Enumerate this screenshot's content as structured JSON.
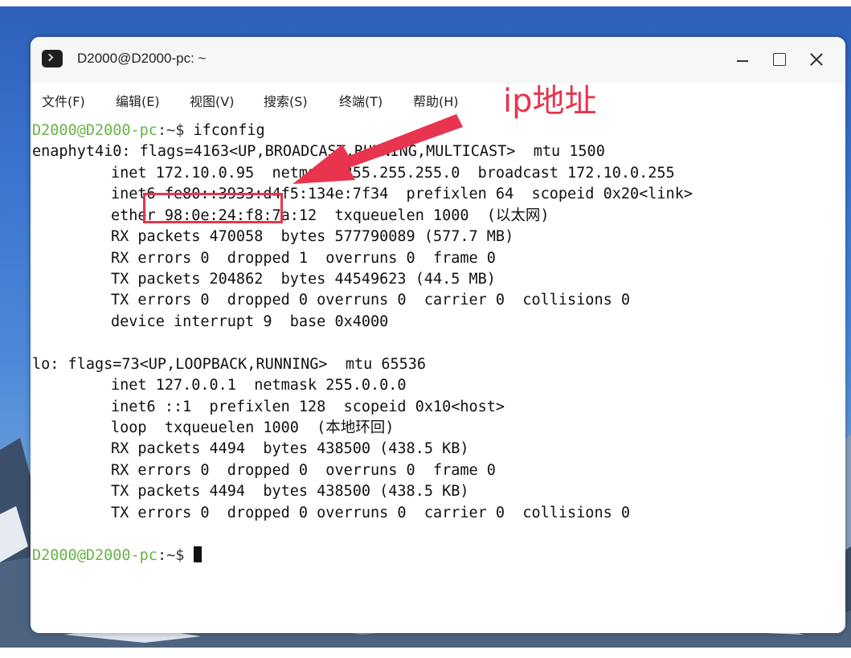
{
  "window": {
    "title": "D2000@D2000-pc: ~"
  },
  "menu": {
    "items": [
      "文件(F)",
      "编辑(E)",
      "视图(V)",
      "搜索(S)",
      "终端(T)",
      "帮助(H)"
    ]
  },
  "annotation": {
    "label": "ip地址",
    "color": "#e8344e"
  },
  "terminal": {
    "prompt_user": "D2000@D2000-pc",
    "prompt_path": ":~$ ",
    "command": "ifconfig",
    "lines": [
      "enaphyt4i0: flags=4163<UP,BROADCAST,RUNNING,MULTICAST>  mtu 1500",
      "inet 172.10.0.95  netmask 255.255.255.0  broadcast 172.10.0.255",
      "inet6 fe80::3933:d4f5:134e:7f34  prefixlen 64  scopeid 0x20<link>",
      "ether 98:0e:24:f8:7a:12  txqueuelen 1000  (以太网)",
      "RX packets 470058  bytes 577790089 (577.7 MB)",
      "RX errors 0  dropped 1  overruns 0  frame 0",
      "TX packets 204862  bytes 44549623 (44.5 MB)",
      "TX errors 0  dropped 0 overruns 0  carrier 0  collisions 0",
      "device interrupt 9  base 0x4000",
      "",
      "lo: flags=73<UP,LOOPBACK,RUNNING>  mtu 65536",
      "inet 127.0.0.1  netmask 255.0.0.0",
      "inet6 ::1  prefixlen 128  scopeid 0x10<host>",
      "loop  txqueuelen 1000  (本地环回)",
      "RX packets 4494  bytes 438500 (438.5 KB)",
      "RX errors 0  dropped 0  overruns 0  frame 0",
      "TX packets 4494  bytes 438500 (438.5 KB)",
      "TX errors 0  dropped 0 overruns 0  carrier 0  collisions 0"
    ],
    "final_prompt_user": "D2000@D2000-pc",
    "final_prompt_path": ":~$ "
  },
  "colors": {
    "prompt_user": "#67b348",
    "accent_red": "#e8344e"
  }
}
